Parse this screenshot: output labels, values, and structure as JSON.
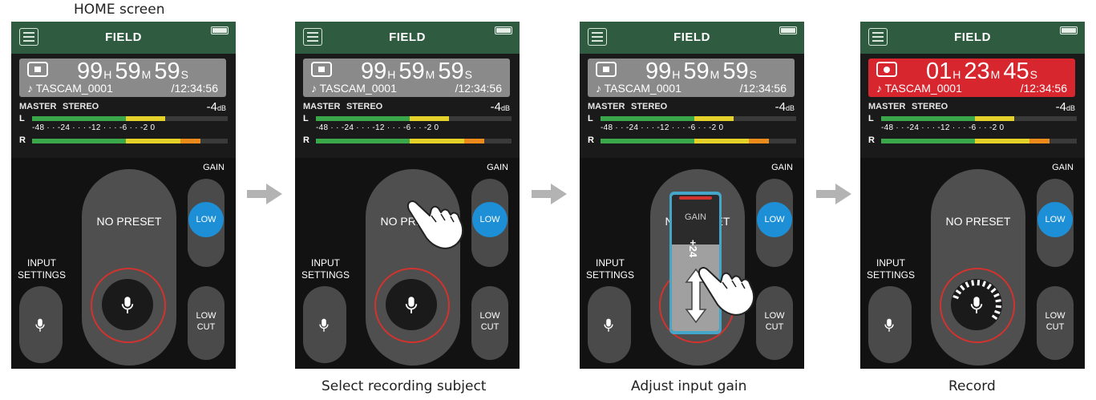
{
  "captions": {
    "home": "HOME screen",
    "step2": "Select recording subject",
    "step3": "Adjust input gain",
    "step4": "Record"
  },
  "screens": [
    {
      "title": "FIELD",
      "status": "stopped",
      "time_h": "99",
      "time_m": "59",
      "time_s": "59",
      "unit_h": "H",
      "unit_m": "M",
      "unit_s": "S",
      "filename": "♪ TASCAM_0001",
      "total_time": "/12:34:56",
      "master_label": "MASTER",
      "stereo_label": "STEREO",
      "level_value": "-4",
      "level_unit": "dB",
      "channel_l": "L",
      "channel_r": "R",
      "scale": "-48 · · -24 · · · -12 · · · -6 · · -2 0",
      "meter_l": 0.68,
      "meter_r": 0.86,
      "preset": "NO PRESET",
      "input_settings": "INPUT\nSETTINGS",
      "gain_label": "GAIN",
      "gain_value": "LOW",
      "low_cut": "LOW\nCUT"
    },
    {
      "title": "FIELD",
      "status": "stopped",
      "time_h": "99",
      "time_m": "59",
      "time_s": "59",
      "unit_h": "H",
      "unit_m": "M",
      "unit_s": "S",
      "filename": "♪ TASCAM_0001",
      "total_time": "/12:34:56",
      "master_label": "MASTER",
      "stereo_label": "STEREO",
      "level_value": "-4",
      "level_unit": "dB",
      "channel_l": "L",
      "channel_r": "R",
      "scale": "-48 · · -24 · · · -12 · · · -6 · · -2 0",
      "meter_l": 0.68,
      "meter_r": 0.86,
      "preset": "NO PRESET",
      "input_settings": "INPUT\nSETTINGS",
      "gain_label": "GAIN",
      "gain_value": "LOW",
      "low_cut": "LOW\nCUT"
    },
    {
      "title": "FIELD",
      "status": "stopped",
      "time_h": "99",
      "time_m": "59",
      "time_s": "59",
      "unit_h": "H",
      "unit_m": "M",
      "unit_s": "S",
      "filename": "♪ TASCAM_0001",
      "total_time": "/12:34:56",
      "master_label": "MASTER",
      "stereo_label": "STEREO",
      "level_value": "-4",
      "level_unit": "dB",
      "channel_l": "L",
      "channel_r": "R",
      "scale": "-48 · · -24 · · · -12 · · · -6 · · -2 0",
      "meter_l": 0.68,
      "meter_r": 0.86,
      "preset": "NO PRESET",
      "input_settings": "INPUT\nSETTINGS",
      "gain_label": "GAIN",
      "gain_value": "LOW",
      "low_cut": "LOW\nCUT",
      "gain_popup_title": "GAIN",
      "gain_popup_value": "+24"
    },
    {
      "title": "FIELD",
      "status": "recording",
      "time_h": "01",
      "time_m": "23",
      "time_s": "45",
      "unit_h": "H",
      "unit_m": "M",
      "unit_s": "S",
      "filename": "♪ TASCAM_0001",
      "total_time": "/12:34:56",
      "master_label": "MASTER",
      "stereo_label": "STEREO",
      "level_value": "-4",
      "level_unit": "dB",
      "channel_l": "L",
      "channel_r": "R",
      "scale": "-48 · · -24 · · · -12 · · · -6 · · -2 0",
      "meter_l": 0.68,
      "meter_r": 0.86,
      "preset": "NO PRESET",
      "input_settings": "INPUT\nSETTINGS",
      "gain_label": "GAIN",
      "gain_value": "LOW",
      "low_cut": "LOW\nCUT"
    }
  ],
  "colors": {
    "title_bar": "#2f5c40",
    "transport_stopped": "#8a8a8a",
    "transport_recording": "#d8262e",
    "meter_green": "#3aa84a",
    "meter_yellow": "#e4d22a",
    "meter_orange": "#ec8a1c",
    "gain_button": "#1d8fd6",
    "mic_ring": "#d2332e",
    "popup_frame": "#44a7c9"
  }
}
